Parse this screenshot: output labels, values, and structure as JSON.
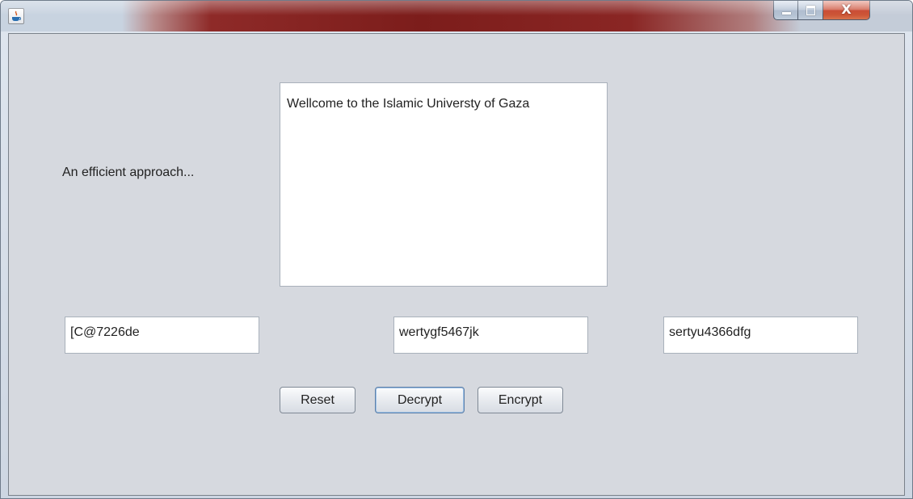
{
  "window": {
    "title": "",
    "controls": {
      "minimize": "minimize",
      "maximize": "maximize",
      "close": "X"
    }
  },
  "main": {
    "description_label": "An efficient approach...",
    "message_area": "Wellcome to the Islamic Universty of Gaza",
    "fields": [
      "[C@7226de",
      "wertygf5467jk",
      "sertyu4366dfg"
    ],
    "buttons": {
      "reset": "Reset",
      "decrypt": "Decrypt",
      "encrypt": "Encrypt"
    }
  },
  "icons": {
    "app": "java-icon"
  },
  "colors": {
    "panel_background": "#d6d9df",
    "titlebar_accent": "#7c1d1b",
    "close_button": "#c2351b"
  }
}
